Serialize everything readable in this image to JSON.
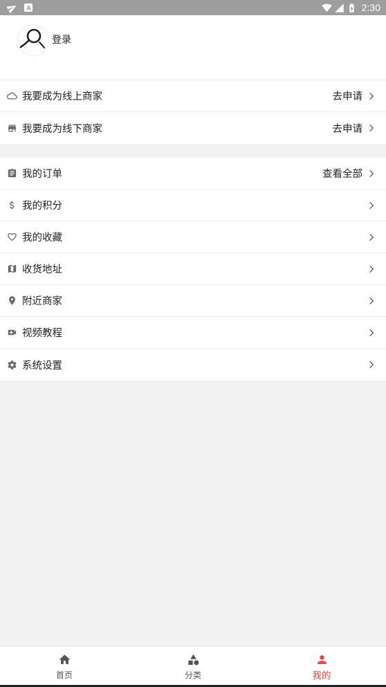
{
  "status_bar": {
    "time": "2:30",
    "left_icons": [
      "send-icon",
      "a-notification-icon"
    ],
    "right_icons": [
      "wifi-icon",
      "signal-icon",
      "battery-icon"
    ]
  },
  "profile": {
    "login_label": "登录",
    "avatar_icon": "avatar-icon"
  },
  "merchant_section": {
    "items": [
      {
        "icon": "cloud-icon",
        "label": "我要成为线上商家",
        "action": "去申请"
      },
      {
        "icon": "store-icon",
        "label": "我要成为线下商家",
        "action": "去申请"
      }
    ]
  },
  "menu_section": {
    "items": [
      {
        "icon": "clipboard-icon",
        "label": "我的订单",
        "action": "查看全部"
      },
      {
        "icon": "dollar-icon",
        "label": "我的积分"
      },
      {
        "icon": "heart-icon",
        "label": "我的收藏"
      },
      {
        "icon": "map-icon",
        "label": "收货地址"
      },
      {
        "icon": "location-pin-icon",
        "label": "附近商家"
      },
      {
        "icon": "video-call-icon",
        "label": "视频教程"
      },
      {
        "icon": "gear-icon",
        "label": "系统设置"
      }
    ]
  },
  "bottom_nav": {
    "items": [
      {
        "icon": "home-icon",
        "label": "首页",
        "active": false
      },
      {
        "icon": "category-icon",
        "label": "分类",
        "active": false
      },
      {
        "icon": "person-icon",
        "label": "我的",
        "active": true
      }
    ]
  },
  "colors": {
    "status_bar": "#9e9e9e",
    "background": "#f2f2f2",
    "card": "#ffffff",
    "text": "#333333",
    "icon": "#666666",
    "accent": "#f44336"
  }
}
